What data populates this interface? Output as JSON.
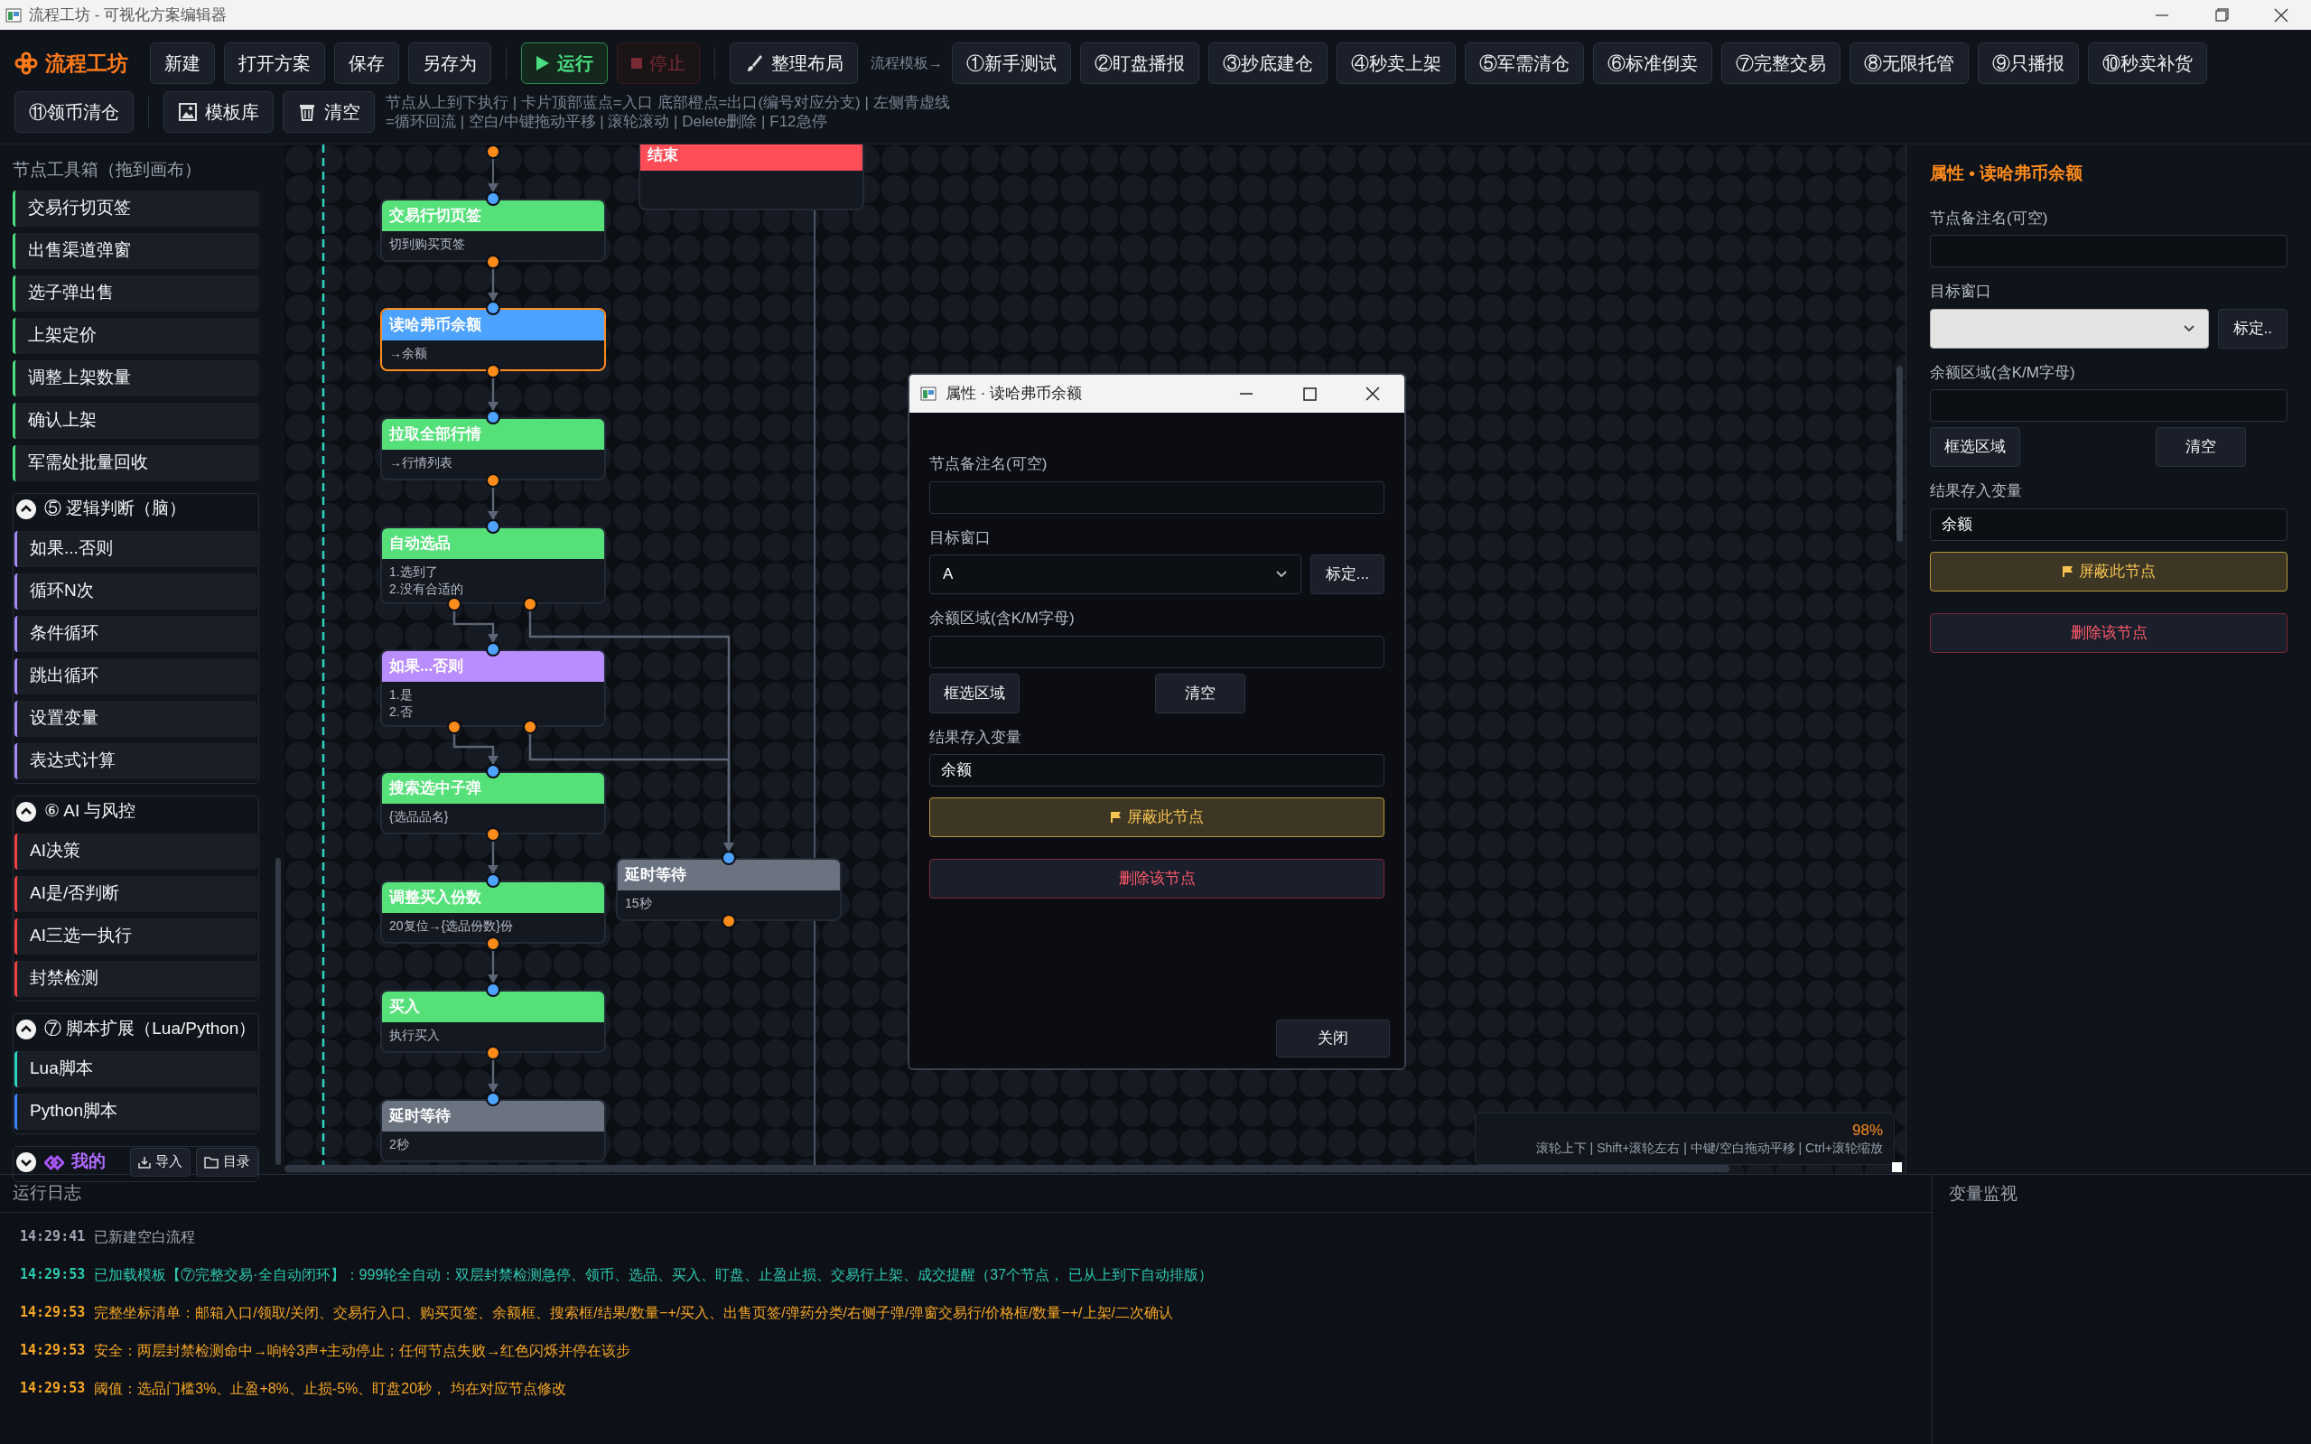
{
  "window": {
    "title": "流程工坊 - 可视化方案编辑器"
  },
  "toolbar": {
    "app_name": "流程工坊",
    "file_buttons": [
      "新建",
      "打开方案",
      "保存",
      "另存为"
    ],
    "run_button": {
      "label": "运行"
    },
    "stop_button": {
      "label": "停止",
      "disabled": true
    },
    "layout_button": "整理布局",
    "templates_label": "流程模板→",
    "templates": [
      "①新手测试",
      "②盯盘播报",
      "③抄底建仓",
      "④秒卖上架",
      "⑤军需清仓",
      "⑥标准倒卖",
      "⑦完整交易",
      "⑧无限托管",
      "⑨只播报",
      "⑩秒卖补货"
    ],
    "templates_row2": [
      "⑪领币清仓"
    ],
    "library_button": "模板库",
    "clear_button": "清空",
    "hint": "节点从上到下执行 | 卡片顶部蓝点=入口 底部橙点=出口(编号对应分支) | 左侧青虚线 =循环回流 | 空白/中键拖动平移 | 滚轮滚动 | Delete删除 | F12急停"
  },
  "toolbox": {
    "title": "节点工具箱（拖到画布）",
    "top_items": [
      {
        "label": "交易行切页签",
        "color": "#4ade80"
      },
      {
        "label": "出售渠道弹窗",
        "color": "#4ade80"
      },
      {
        "label": "选子弹出售",
        "color": "#4ade80"
      },
      {
        "label": "上架定价",
        "color": "#4ade80"
      },
      {
        "label": "调整上架数量",
        "color": "#4ade80"
      },
      {
        "label": "确认上架",
        "color": "#4ade80"
      },
      {
        "label": "军需处批量回收",
        "color": "#4ade80"
      }
    ],
    "groups": [
      {
        "title": "⑤ 逻辑判断（脑）",
        "expanded": true,
        "items": [
          {
            "label": "如果...否则",
            "color": "#a78bfa"
          },
          {
            "label": "循环N次",
            "color": "#a78bfa"
          },
          {
            "label": "条件循环",
            "color": "#a78bfa"
          },
          {
            "label": "跳出循环",
            "color": "#a78bfa"
          },
          {
            "label": "设置变量",
            "color": "#a78bfa"
          },
          {
            "label": "表达式计算",
            "color": "#a78bfa"
          }
        ]
      },
      {
        "title": "⑥ AI 与风控",
        "expanded": true,
        "items": [
          {
            "label": "AI决策",
            "color": "#ef4444"
          },
          {
            "label": "AI是/否判断",
            "color": "#ef4444"
          },
          {
            "label": "AI三选一执行",
            "color": "#ef4444"
          },
          {
            "label": "封禁检测",
            "color": "#ef4444"
          }
        ]
      },
      {
        "title": "⑦ 脚本扩展（Lua/Python）",
        "expanded": true,
        "items": [
          {
            "label": "Lua脚本",
            "color": "#2dd4bf"
          },
          {
            "label": "Python脚本",
            "color": "#3b82f6"
          }
        ]
      },
      {
        "title": "我的",
        "expanded": false,
        "buttons": [
          "导入",
          "目录"
        ]
      }
    ]
  },
  "canvas": {
    "nodes": [
      {
        "title": "结束",
        "kind": "end",
        "selected": false
      },
      {
        "title": "交易行切页签",
        "kind": "action",
        "lines": [
          "切到购买页签"
        ],
        "selected": false
      },
      {
        "title": "读哈弗币余额",
        "kind": "read",
        "lines": [
          "→余额"
        ],
        "selected": true
      },
      {
        "title": "拉取全部行情",
        "kind": "action",
        "lines": [
          "→行情列表"
        ],
        "selected": false
      },
      {
        "title": "自动选品",
        "kind": "action",
        "lines": [
          "1.选到了",
          "2.没有合适的"
        ],
        "selected": false
      },
      {
        "title": "如果...否则",
        "kind": "logic",
        "lines": [
          "1.是",
          "2.否"
        ],
        "selected": false
      },
      {
        "title": "搜索选中子弹",
        "kind": "action",
        "lines": [
          "{选品品名}"
        ],
        "selected": false
      },
      {
        "title": "调整买入份数",
        "kind": "action",
        "lines": [
          "20复位→{选品份数}份"
        ],
        "selected": false
      },
      {
        "title": "延时等待",
        "kind": "wait",
        "lines": [
          "15秒"
        ],
        "selected": false
      },
      {
        "title": "买入",
        "kind": "action",
        "lines": [
          "执行买入"
        ],
        "selected": false
      },
      {
        "title": "延时等待",
        "kind": "wait",
        "lines": [
          "2秒"
        ],
        "selected": false
      }
    ],
    "zoom": "98%",
    "zoom_hint": "滚轮上下 | Shift+滚轮左右 | 中键/空白拖动平移 | Ctrl+滚轮缩放"
  },
  "dialog": {
    "title": "属性 · 读哈弗币余额",
    "note_label": "节点备注名(可空)",
    "window_label": "目标窗口",
    "window_value": "A",
    "calibrate_button": "标定...",
    "region_label": "余额区域(含K/M字母)",
    "select_button": "框选区域",
    "clear_button": "清空",
    "variable_label": "结果存入变量",
    "variable_value": "余额",
    "disable_button": "屏蔽此节点",
    "delete_button": "删除该节点",
    "close_button": "关闭"
  },
  "properties": {
    "title": "属性 • 读哈弗币余额",
    "note_label": "节点备注名(可空)",
    "window_label": "目标窗口",
    "calibrate_button": "标定..",
    "region_label": "余额区域(含K/M字母)",
    "select_button": "框选区域",
    "clear_button": "清空",
    "variable_label": "结果存入变量",
    "variable_value": "余额",
    "disable_button": "屏蔽此节点",
    "delete_button": "删除该节点"
  },
  "log": {
    "title": "运行日志",
    "entries": [
      {
        "time": "14:29:41",
        "text": "已新建空白流程",
        "kind": "info"
      },
      {
        "time": "14:29:53",
        "text": "已加载模板【⑦完整交易·全自动闭环】：999轮全自动：双层封禁检测急停、领币、选品、买入、盯盘、止盈止损、交易行上架、成交提醒（37个节点， 已从上到下自动排版）",
        "kind": "success"
      },
      {
        "time": "14:29:53",
        "text": "完整坐标清单：邮箱入口/领取/关闭、交易行入口、购买页签、余额框、搜索框/结果/数量−+/买入、出售页签/弹药分类/右侧子弹/弹窗交易行/价格框/数量−+/上架/二次确认",
        "kind": "warn"
      },
      {
        "time": "14:29:53",
        "text": "安全：两层封禁检测命中→响铃3声+主动停止；任何节点失败→红色闪烁并停在该步",
        "kind": "warn"
      },
      {
        "time": "14:29:53",
        "text": "阈值：选品门槛3%、止盈+8%、止损-5%、盯盘20秒， 均在对应节点修改",
        "kind": "warn"
      }
    ]
  },
  "variables": {
    "title": "变量监视"
  }
}
